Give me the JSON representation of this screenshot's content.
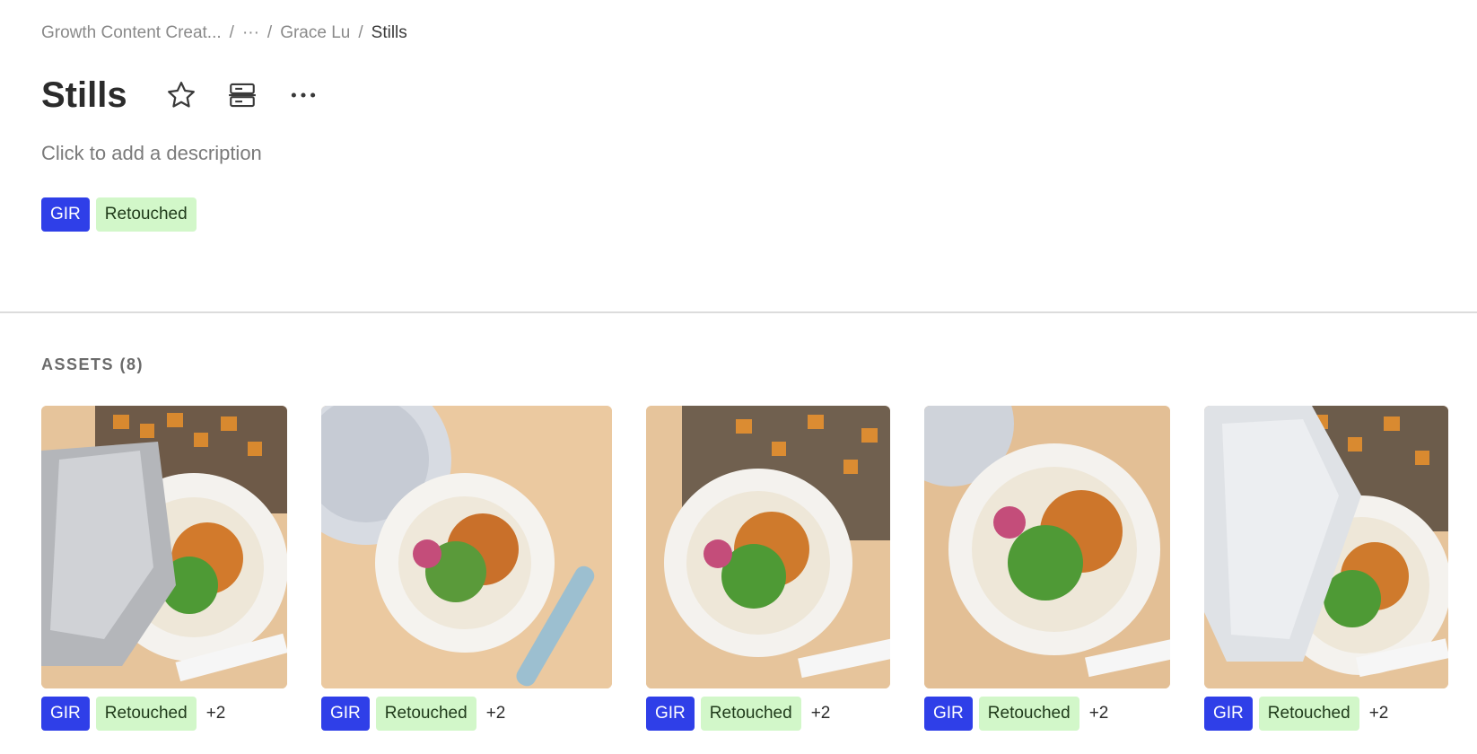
{
  "breadcrumb": {
    "items": [
      "Growth Content Creat...",
      "···",
      "Grace Lu"
    ],
    "current": "Stills",
    "separator": "/"
  },
  "header": {
    "title": "Stills",
    "description_placeholder": "Click to add a description",
    "icons": [
      "star-icon",
      "layout-icon",
      "more-icon"
    ],
    "tags": [
      "GIR",
      "Retouched"
    ]
  },
  "assets_section": {
    "label": "ASSETS (8)",
    "assets": [
      {
        "tags": [
          "GIR",
          "Retouched"
        ],
        "more": "+2"
      },
      {
        "tags": [
          "GIR",
          "Retouched"
        ],
        "more": "+2"
      },
      {
        "tags": [
          "GIR",
          "Retouched"
        ],
        "more": "+2"
      },
      {
        "tags": [
          "GIR",
          "Retouched"
        ],
        "more": "+2"
      },
      {
        "tags": [
          "GIR",
          "Retouched"
        ],
        "more": "+2"
      }
    ]
  },
  "colors": {
    "tag_gir_bg": "#2f3fe8",
    "tag_retouched_bg": "#d2f7c9",
    "divider": "#dcdcdc"
  }
}
